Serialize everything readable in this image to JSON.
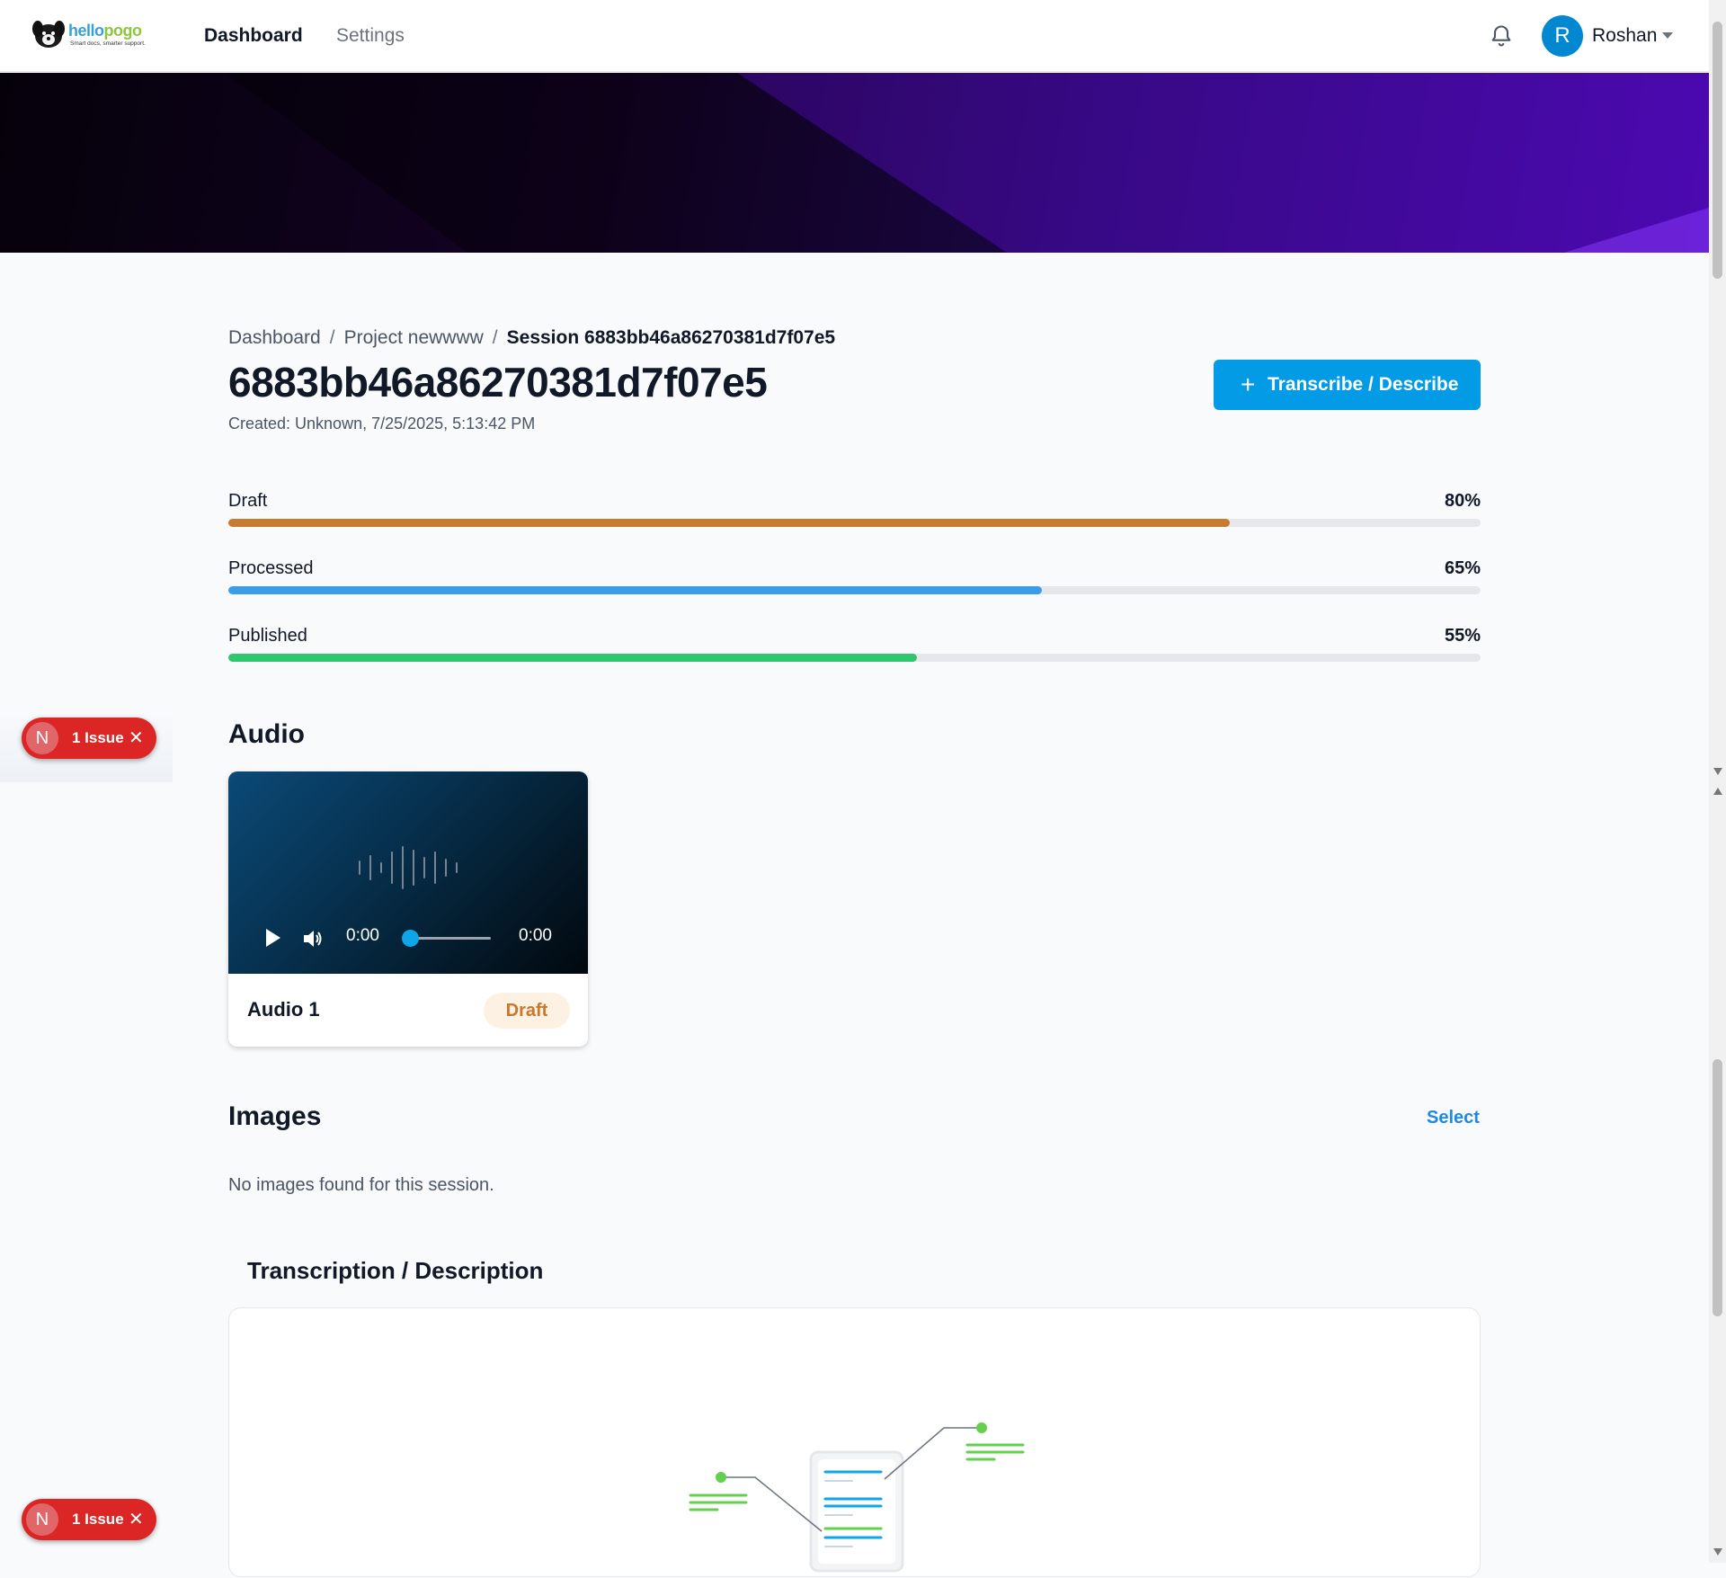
{
  "nav": {
    "logo_brand_hello": "hello",
    "logo_brand_pogo": "pogo",
    "logo_tagline": "Smart docs, smarter support.",
    "dashboard": "Dashboard",
    "settings": "Settings",
    "user_initial": "R",
    "user_name": "Roshan"
  },
  "breadcrumb": {
    "items": [
      "Dashboard",
      "Project newwww"
    ],
    "separator": "/",
    "current": "Session 6883bb46a86270381d7f07e5"
  },
  "session": {
    "title": "6883bb46a86270381d7f07e5",
    "created": "Created: Unknown, 7/25/2025, 5:13:42 PM",
    "primary_button": "Transcribe / Describe",
    "primary_button_icon": "+"
  },
  "progress": [
    {
      "label": "Draft",
      "value_text": "80%",
      "value": 0.8,
      "color": "#c87b2e"
    },
    {
      "label": "Processed",
      "value_text": "65%",
      "value": 0.65,
      "color": "#3b9de8"
    },
    {
      "label": "Published",
      "value_text": "55%",
      "value": 0.55,
      "color": "#2ec76b"
    }
  ],
  "audio": {
    "section_title": "Audio",
    "items": [
      {
        "name": "Audio 1",
        "status": "Draft",
        "current_time": "0:00",
        "duration": "0:00",
        "progress": 0.0
      }
    ]
  },
  "images": {
    "section_title": "Images",
    "select_label": "Select",
    "empty_message": "No images found for this session."
  },
  "transcription": {
    "section_title": "Transcription / Description"
  },
  "issues": {
    "badge_initial": "N",
    "label": "1 Issue",
    "close": "✕"
  },
  "colors": {
    "accent": "#039be5",
    "issue_red": "#dc2626",
    "draft_badge_bg": "#fdf1e3",
    "draft_badge_text": "#c8782a"
  }
}
